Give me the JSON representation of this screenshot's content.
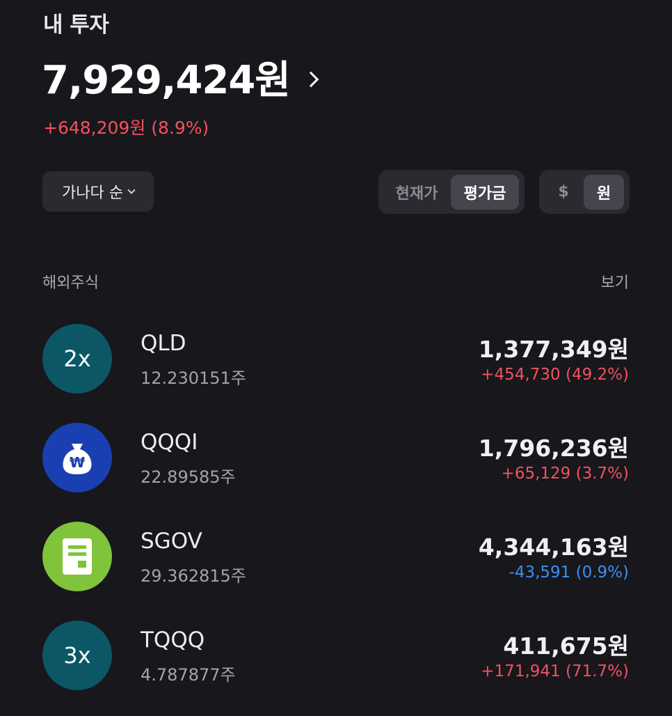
{
  "header": {
    "title": "내 투자",
    "total": "7,929,424원",
    "gain": "+648,209원 (8.9%)",
    "gain_color": "#f0525e"
  },
  "controls": {
    "sort_label": "가나다 순",
    "price_toggle": [
      "현재가",
      "평가금"
    ],
    "price_toggle_selected": "평가금",
    "currency_toggle": [
      "$",
      "원"
    ],
    "currency_toggle_selected": "원"
  },
  "section": {
    "label": "해외주식",
    "view_label": "보기"
  },
  "holdings": [
    {
      "logo_text": "2x",
      "logo_color": "#0b5766",
      "name": "QLD",
      "quantity": "12.230151주",
      "value": "1,377,349원",
      "change": "+454,730 (49.2%)",
      "change_color": "#f0525e"
    },
    {
      "logo_text": "",
      "logo_icon": "money-bag-won-icon",
      "logo_color": "#1a3fb0",
      "name": "QQQI",
      "quantity": "22.89585주",
      "value": "1,796,236원",
      "change": "+65,129 (3.7%)",
      "change_color": "#f0525e"
    },
    {
      "logo_text": "",
      "logo_icon": "document-icon",
      "logo_color": "#7fc43a",
      "name": "SGOV",
      "quantity": "29.362815주",
      "value": "4,344,163원",
      "change": "-43,591 (0.9%)",
      "change_color": "#3d8ef5"
    },
    {
      "logo_text": "3x",
      "logo_color": "#0b5766",
      "name": "TQQQ",
      "quantity": "4.787877주",
      "value": "411,675원",
      "change": "+171,941 (71.7%)",
      "change_color": "#f0525e"
    }
  ]
}
